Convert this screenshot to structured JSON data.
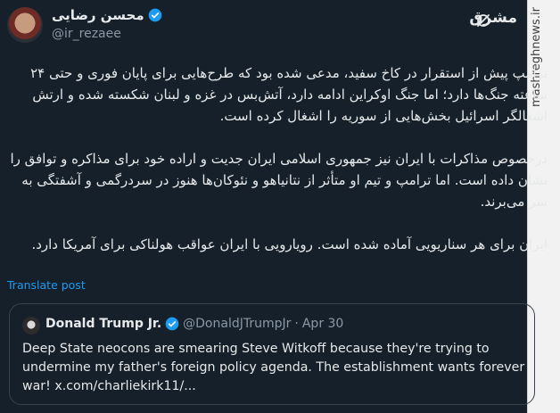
{
  "author": {
    "name": "محسن رضایی",
    "handle": "@ir_rezaee"
  },
  "brand": {
    "logo_text": "مشرق",
    "watermark": "mashreghnews.ir"
  },
  "tweet": {
    "paragraphs": [
      "ترامپ پیش از استقرار در کاخ سفید، مدعی شده بود که طرح‌هایی برای پایان فوری و حتی ۲۴ ساعته جنگ‌ها دارد؛ اما جنگ اوکراین ادامه دارد، آتش‌بس در غزه و لبنان شکسته شده و ارتش اشغالگر اسرائیل بخش‌هایی از سوریه را اشغال کرده است.",
      "درخصوص مذاکرات با ایران نیز جمهوری اسلامی ایران جدیت و اراده خود برای مذاکره و توافق را نشان داده است. اما ترامپ و تیم او متأثر از نتانیاهو و نئوکان‌ها هنوز در سردرگمی و آشفتگی به سر می‌برند.",
      "ایران برای هر سناریویی آماده شده است. رویارویی با ایران عواقب هولناکی برای آمریکا دارد."
    ],
    "translate_label": "Translate post"
  },
  "quote": {
    "name": "Donald Trump Jr.",
    "handle": "@DonaldJTrumpJr",
    "separator": "·",
    "date": "Apr 30",
    "text": "Deep State neocons are smearing Steve Witkoff because they're trying to undermine my father's foreign policy agenda. The establishment wants forever war! x.com/charliekirk11/..."
  },
  "colors": {
    "background": "#15202b",
    "verified": "#1d9bf0",
    "link": "#1d9bf0"
  }
}
